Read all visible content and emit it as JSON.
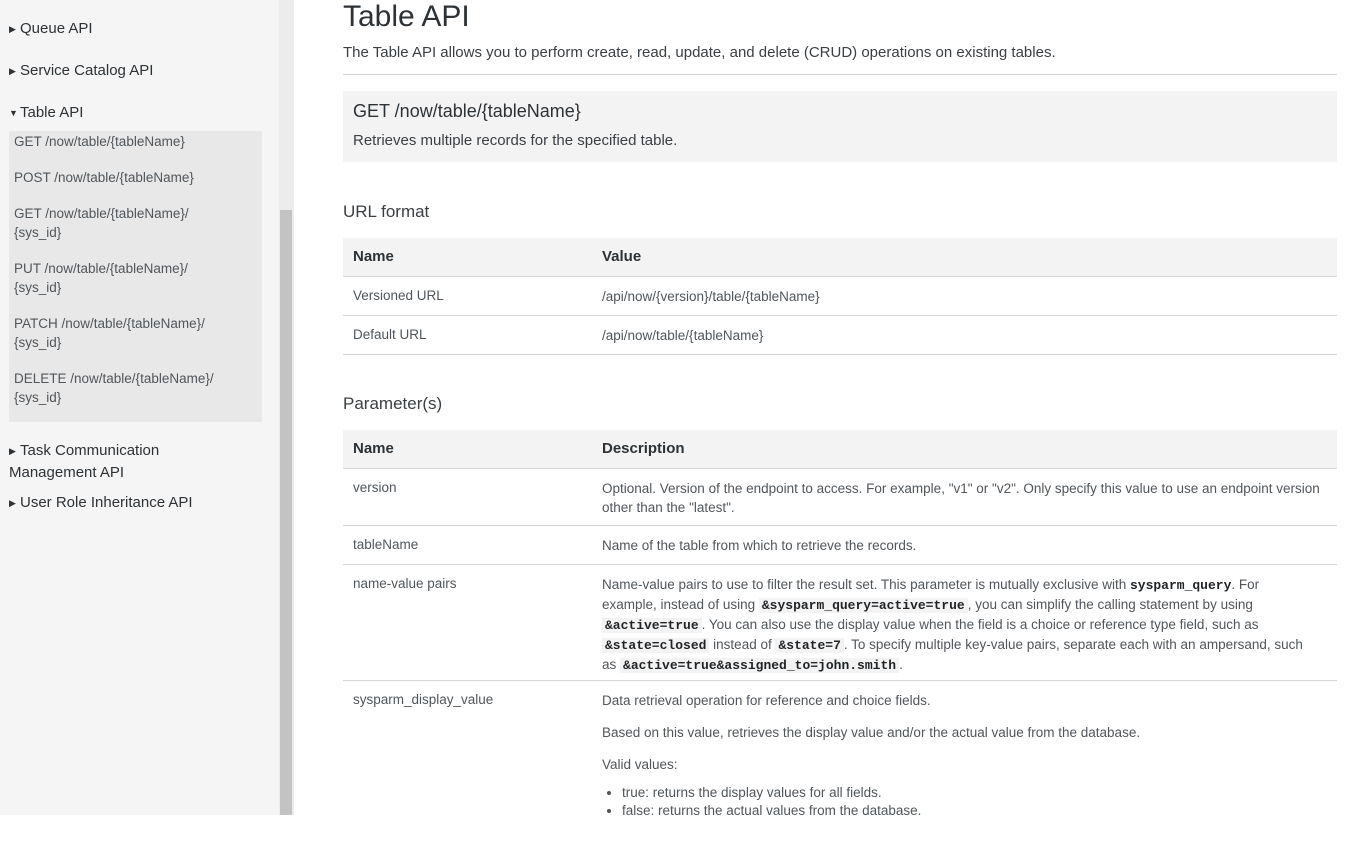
{
  "sidebar": {
    "top_items": [
      {
        "label": "Queue API",
        "expanded": false
      },
      {
        "label": "Service Catalog API",
        "expanded": false
      },
      {
        "label": "Table API",
        "expanded": true
      }
    ],
    "sub_items": [
      {
        "line1": "GET /now/table/{tableName}",
        "line2": ""
      },
      {
        "line1": "POST /now/table/{tableName}",
        "line2": ""
      },
      {
        "line1": "GET /now/table/{tableName}/",
        "line2": "{sys_id}"
      },
      {
        "line1": "PUT /now/table/{tableName}/",
        "line2": "{sys_id}"
      },
      {
        "line1": "PATCH /now/table/{tableName}/",
        "line2": "{sys_id}"
      },
      {
        "line1": "DELETE /now/table/{tableName}/",
        "line2": "{sys_id}"
      }
    ],
    "bottom_items": [
      {
        "line1": "Task Communication",
        "line2": "Management API"
      },
      {
        "line1": "User Role Inheritance API",
        "line2": ""
      }
    ]
  },
  "page": {
    "title": "Table API",
    "intro": "The Table API allows you to perform create, read, update, and delete (CRUD) operations on existing tables.",
    "endpoint": {
      "title": "GET /now/table/{tableName}",
      "description": "Retrieves multiple records for the specified table."
    },
    "url_format": {
      "title": "URL format",
      "headers": [
        "Name",
        "Value"
      ],
      "rows": [
        {
          "name": "Versioned URL",
          "value": "/api/now/{version}/table/{tableName}"
        },
        {
          "name": "Default URL",
          "value": "/api/now/table/{tableName}"
        }
      ]
    },
    "parameters": {
      "title": "Parameter(s)",
      "headers": [
        "Name",
        "Description"
      ],
      "version": {
        "name": "version",
        "desc": "Optional. Version of the endpoint to access. For example, \"v1\" or \"v2\". Only specify this value to use an endpoint version other than the \"latest\"."
      },
      "tableName": {
        "name": "tableName",
        "desc": "Name of the table from which to retrieve the records."
      },
      "name_value": {
        "name": "name-value pairs",
        "t1": "Name-value pairs to use to filter the result set. This parameter is mutually exclusive with ",
        "c1": "sysparm_query",
        "t2": ". For example, instead of using ",
        "c2": "&sysparm_query=active=true",
        "t3": ", you can simplify the calling statement by using ",
        "c3": "&active=true",
        "t4": ". You can also use the display value when the field is a choice or reference type field, such as ",
        "c4": "&state=closed",
        "t5": " instead of ",
        "c5": "&state=7",
        "t6": ". To specify multiple key-value pairs, separate each with an ampersand, such as ",
        "c6": "&active=true&assigned_to=john.smith",
        "t7": "."
      },
      "display_value": {
        "name": "sysparm_display_value",
        "p1": "Data retrieval operation for reference and choice fields.",
        "p2": "Based on this value, retrieves the display value and/or the actual value from the database.",
        "p3": "Valid values:",
        "li1": "true: returns the display values for all fields.",
        "li2": "false: returns the actual values from the database."
      }
    }
  }
}
